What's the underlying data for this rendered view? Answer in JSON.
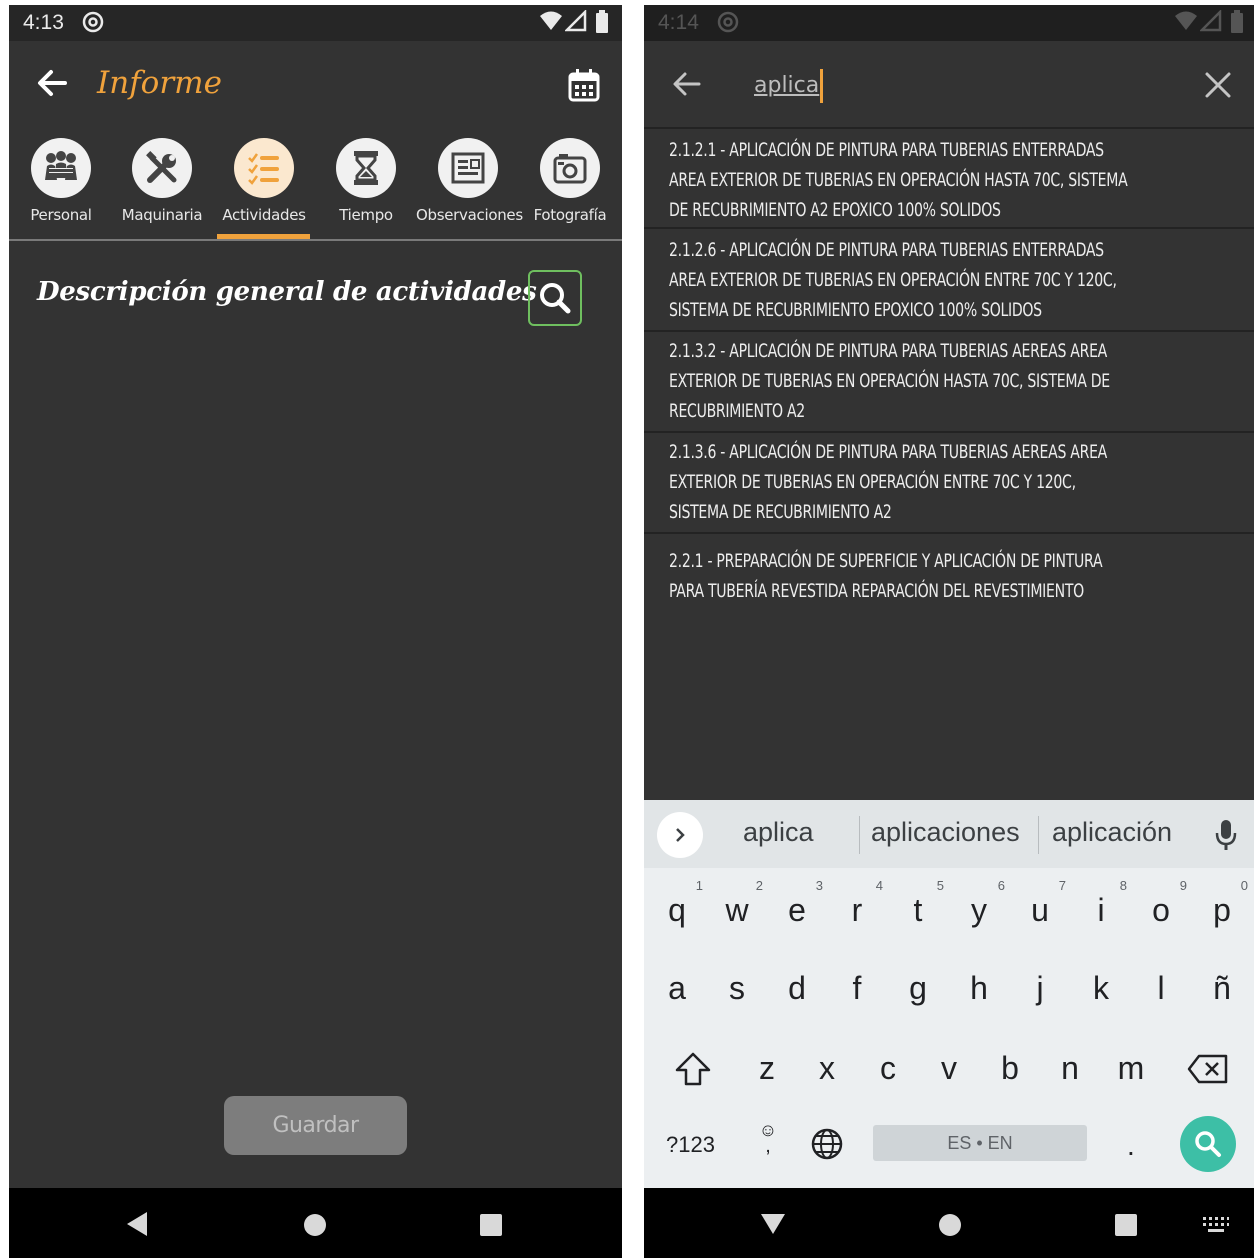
{
  "left_screen": {
    "status": {
      "time": "4:13"
    },
    "appbar": {
      "title": "Informe"
    },
    "tabs": [
      {
        "label": "Personal",
        "icon": "people-icon"
      },
      {
        "label": "Maquinaria",
        "icon": "tools-icon"
      },
      {
        "label": "Actividades",
        "icon": "checklist-icon",
        "active": true
      },
      {
        "label": "Tiempo",
        "icon": "hourglass-icon"
      },
      {
        "label": "Observaciones",
        "icon": "notes-icon"
      },
      {
        "label": "Fotografía",
        "icon": "camera-icon"
      }
    ],
    "section_title": "Descripción general de actividades",
    "save_label": "Guardar",
    "accent_color": "#f0a23c",
    "background_color": "#333333"
  },
  "right_screen": {
    "status": {
      "time": "4:14"
    },
    "search": {
      "query": "aplica"
    },
    "results": [
      {
        "lines": [
          "2.1.2.1 - APLICACIÓN DE PINTURA PARA TUBERIAS ENTERRADAS",
          "AREA EXTERIOR DE TUBERIAS EN OPERACIÓN HASTA 70C, SISTEMA",
          "DE RECUBRIMIENTO A2  EPOXICO 100% SOLIDOS"
        ]
      },
      {
        "lines": [
          "2.1.2.6 - APLICACIÓN DE PINTURA PARA TUBERIAS ENTERRADAS",
          "AREA EXTERIOR DE TUBERIAS EN OPERACIÓN ENTRE  70C Y 120C,",
          "SISTEMA DE RECUBRIMIENTO EPOXICO   100% SOLIDOS"
        ]
      },
      {
        "lines": [
          "2.1.3.2 - APLICACIÓN DE PINTURA PARA TUBERIAS AEREAS  AREA",
          "EXTERIOR DE TUBERIAS EN OPERACIÓN HASTA 70C, SISTEMA DE",
          "RECUBRIMIENTO A2"
        ]
      },
      {
        "lines": [
          "2.1.3.6 - APLICACIÓN DE PINTURA PARA TUBERIAS AEREAS AREA",
          "EXTERIOR DE TUBERIAS EN OPERACIÓN ENTRE  70C Y 120C,",
          "SISTEMA DE RECUBRIMIENTO A2"
        ]
      },
      {
        "lines": [
          "2.2.1 - PREPARACIÓN  DE SUPERFICIE Y APLICACIÓN DE PINTURA",
          "PARA TUBERÍA REVESTIDA REPARACIÓN DEL REVESTIMIENTO"
        ]
      }
    ],
    "keyboard": {
      "suggestions": [
        "aplica",
        "aplicaciones",
        "aplicación"
      ],
      "row1": [
        "q",
        "w",
        "e",
        "r",
        "t",
        "y",
        "u",
        "i",
        "o",
        "p"
      ],
      "row1_hints": [
        "1",
        "2",
        "3",
        "4",
        "5",
        "6",
        "7",
        "8",
        "9",
        "0"
      ],
      "row2": [
        "a",
        "s",
        "d",
        "f",
        "g",
        "h",
        "j",
        "k",
        "l",
        "ñ"
      ],
      "row3": [
        "z",
        "x",
        "c",
        "v",
        "b",
        "n",
        "m"
      ],
      "symbols_label": "?123",
      "emoji_label": "☺",
      "comma_label": ",",
      "space_label": "ES • EN",
      "period_label": ".",
      "search_key_color": "#3dbfa6"
    }
  }
}
